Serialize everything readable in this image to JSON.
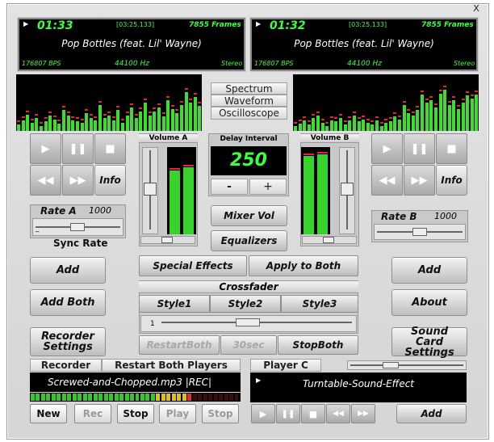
{
  "window": {
    "close_glyph": "X"
  },
  "player_a_display": {
    "time": "01:33",
    "total": "[03:25.133]",
    "frames": "7855 Frames",
    "title": "Pop Bottles (feat. Lil' Wayne)",
    "bps": "176807 BPS",
    "rate": "44100 Hz",
    "mode": "Stereo"
  },
  "player_b_display": {
    "time": "01:32",
    "total": "[03:25.133]",
    "frames": "7855 Frames",
    "title": "Pop Bottles (feat. Lil' Wayne)",
    "bps": "176807 BPS",
    "rate": "44100 Hz",
    "mode": "Stereo"
  },
  "viz_modes": [
    "Spectrum",
    "Waveform",
    "Oscilloscope"
  ],
  "spectrum_a": [
    0.12,
    0.2,
    0.32,
    0.15,
    0.25,
    0.1,
    0.18,
    0.3,
    0.22,
    0.14,
    0.4,
    0.3,
    0.2,
    0.18,
    0.15,
    0.35,
    0.25,
    0.2,
    0.5,
    0.25,
    0.3,
    0.2,
    0.4,
    0.15,
    0.3,
    0.45,
    0.25,
    0.38,
    0.55,
    0.3,
    0.38,
    0.45,
    0.28,
    0.6,
    0.42,
    0.35,
    0.5,
    0.75,
    0.55,
    0.65,
    0.48
  ],
  "spectrum_b": [
    0.1,
    0.14,
    0.2,
    0.12,
    0.25,
    0.3,
    0.15,
    0.1,
    0.2,
    0.18,
    0.25,
    0.12,
    0.2,
    0.3,
    0.18,
    0.22,
    0.15,
    0.12,
    0.2,
    0.1,
    0.15,
    0.18,
    0.28,
    0.22,
    0.5,
    0.35,
    0.3,
    0.4,
    0.7,
    0.55,
    0.6,
    0.45,
    0.72,
    0.8,
    0.5,
    0.6,
    0.42,
    0.55,
    0.68,
    0.62,
    0.7
  ],
  "player_a_controls": {
    "info": "Info"
  },
  "player_b_controls": {
    "info": "Info"
  },
  "volume_a": {
    "label": "Volume A",
    "meter_left": 0.73,
    "meter_right": 0.77
  },
  "volume_b": {
    "label": "Volume B",
    "meter_left": 0.9,
    "meter_right": 0.92
  },
  "delay": {
    "label": "Delay Interval",
    "value": "250",
    "minus": "-",
    "plus": "+"
  },
  "rate_a": {
    "label": "Rate A",
    "value": "1000",
    "sync": "Sync Rate",
    "minus": "_"
  },
  "rate_b": {
    "label": "Rate B",
    "value": "1000"
  },
  "center_buttons": {
    "mixer_vol": "Mixer Vol",
    "equalizers": "Equalizers"
  },
  "left_buttons": {
    "add": "Add",
    "add_both": "Add Both",
    "recorder_settings": "Recorder Settings"
  },
  "right_buttons": {
    "add": "Add",
    "about": "About",
    "sound_card_settings": "Sound Card Settings"
  },
  "effects": {
    "special": "Special Effects",
    "apply_both": "Apply to Both"
  },
  "crossfader": {
    "label": "Crossfader",
    "styles": [
      "Style1",
      "Style2",
      "Style3"
    ],
    "tick_label": "1"
  },
  "transport_both": {
    "restart": "RestartBoth",
    "sec30": "30sec",
    "stop": "StopBoth"
  },
  "recorder": {
    "label": "Recorder",
    "restart_both": "Restart Both Players",
    "file": "Screwed-and-Chopped.mp3 |REC|",
    "buttons": [
      "New",
      "Rec",
      "Stop",
      "Play",
      "Stop"
    ],
    "level": 0.77
  },
  "player_c": {
    "label": "Player C",
    "track": "Turntable-Sound-Effect",
    "add": "Add"
  }
}
